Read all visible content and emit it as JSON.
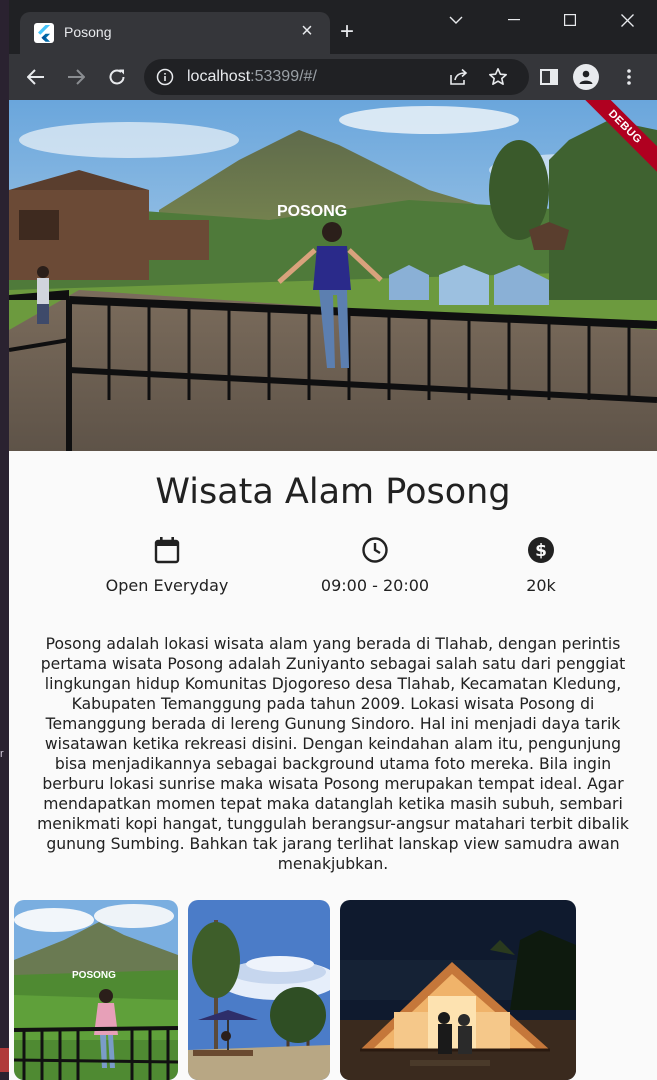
{
  "browser": {
    "tab_title": "Posong",
    "url_host": "localhost",
    "url_rest": ":53399/#/"
  },
  "page": {
    "debug_banner": "DEBUG",
    "hero_sign": "POSONG",
    "title": "Wisata Alam Posong",
    "info": [
      {
        "icon": "calendar-icon",
        "label": "Open Everyday"
      },
      {
        "icon": "clock-icon",
        "label": "09:00 - 20:00"
      },
      {
        "icon": "dollar-icon",
        "label": "20k"
      }
    ],
    "description": "Posong adalah lokasi wisata alam yang berada di Tlahab, dengan perintis pertama wisata Posong adalah Zuniyanto sebagai salah satu dari penggiat lingkungan hidup Komunitas Djogoreso desa Tlahab, Kecamatan Kledung, Kabupaten Temanggung pada tahun 2009. Lokasi wisata Posong di Temanggung berada di lereng Gunung Sindoro. Hal ini  menjadi daya tarik wisatawan ketika rekreasi disini. Dengan keindahan alam itu, pengunjung bisa menjadikannya sebagai background utama foto mereka. Bila ingin berburu lokasi sunrise maka wisata Posong merupakan tempat ideal. Agar mendapatkan momen tepat maka datanglah ketika masih subuh, sembari menikmati kopi hangat, tunggulah berangsur-angsur matahari terbit dibalik gunung Sumbing. Bahkan tak jarang terlihat lanskap view samudra awan menakjubkan.",
    "gallery_sign": "POSONG"
  },
  "colors": {
    "accent_debug": "#b00020",
    "text": "#212121",
    "background": "#fafafa"
  }
}
